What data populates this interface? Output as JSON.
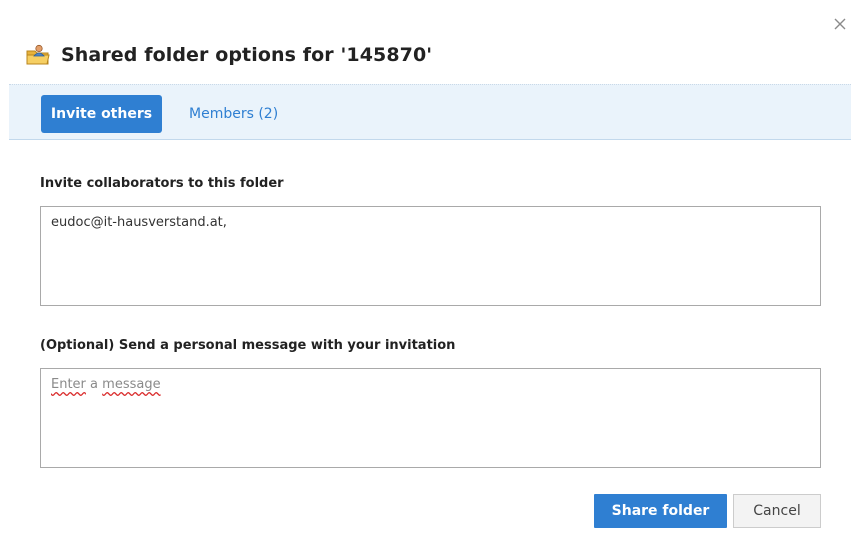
{
  "dialog": {
    "title": "Shared folder options for '145870'",
    "title_icon": "shared-folder-icon",
    "close_icon": "close-icon"
  },
  "tabs": [
    {
      "label": "Invite others",
      "active": true
    },
    {
      "label": "Members (2)",
      "active": false
    }
  ],
  "invite": {
    "label": "Invite collaborators to this folder",
    "value": "eudoc@it-hausverstand.at,"
  },
  "message": {
    "label": "(Optional) Send a personal message with your invitation",
    "placeholder_word1": "Enter",
    "placeholder_word2": "a",
    "placeholder_word3": "message"
  },
  "buttons": {
    "share": "Share folder",
    "cancel": "Cancel"
  },
  "colors": {
    "accent": "#2f7fd2",
    "tabbar_bg": "#eaf3fb"
  }
}
